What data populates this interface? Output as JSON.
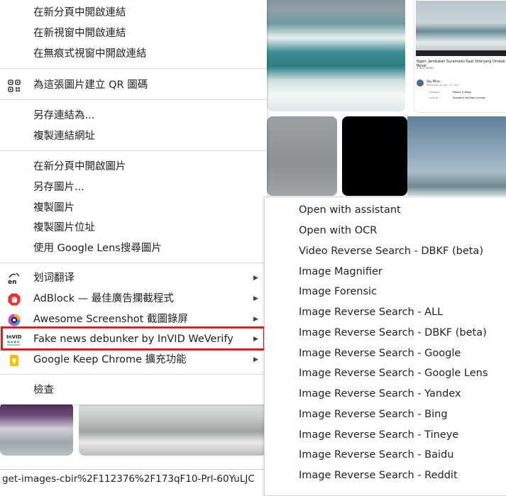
{
  "background": {
    "yt_card": {
      "title": "Ngeri, Jembatan Suramadu Saat Diterjang Ombak Besar",
      "views": "2,423 views",
      "channel": "Sby Milan",
      "published": "Published on Dec 13, 2017",
      "category_label": "Category",
      "category_value": "People & Blogs",
      "license_label": "License",
      "license_value": "Standard YouTube License"
    }
  },
  "status_bar": {
    "url_fragment": "get-images-cbir%2F112376%2F173qF10-Prl-60YuLJC"
  },
  "context_menu": {
    "group1": [
      "在新分頁中開啟連結",
      "在新視窗中開啟連結",
      "在無痕式視窗中開啟連結"
    ],
    "qr": "為這張圖片建立 QR 圖碼",
    "group2": [
      "另存連結為...",
      "複製連結網址"
    ],
    "group3": [
      "在新分頁中開啟圖片",
      "另存圖片...",
      "複製圖片",
      "複製圖片位址",
      "使用 Google Lens搜尋圖片"
    ],
    "extensions": [
      {
        "label": "划词翻译",
        "icon": "translate-icon"
      },
      {
        "label": "AdBlock — 最佳廣告攔截程式",
        "icon": "adblock-icon"
      },
      {
        "label": "Awesome Screenshot 截圖錄屏",
        "icon": "awesome-screenshot-icon"
      },
      {
        "label": "Fake news debunker by InVID  WeVerify",
        "icon": "invid-icon"
      },
      {
        "label": "Google Keep Chrome 擴充功能",
        "icon": "google-keep-icon"
      }
    ],
    "inspect": "檢查",
    "highlight_color": "#e11b22"
  },
  "submenu": {
    "items": [
      "Open with assistant",
      "Open with OCR",
      "Video Reverse Search - DBKF (beta)",
      "Image Magnifier",
      "Image Forensic",
      "Image Reverse Search - ALL",
      "Image Reverse Search - DBKF (beta)",
      "Image Reverse Search - Google",
      "Image Reverse Search - Google Lens",
      "Image Reverse Search - Yandex",
      "Image Reverse Search - Bing",
      "Image Reverse Search - Tineye",
      "Image Reverse Search - Baidu",
      "Image Reverse Search - Reddit"
    ]
  },
  "icon_text": {
    "translate": "en",
    "invid": "InVID"
  }
}
